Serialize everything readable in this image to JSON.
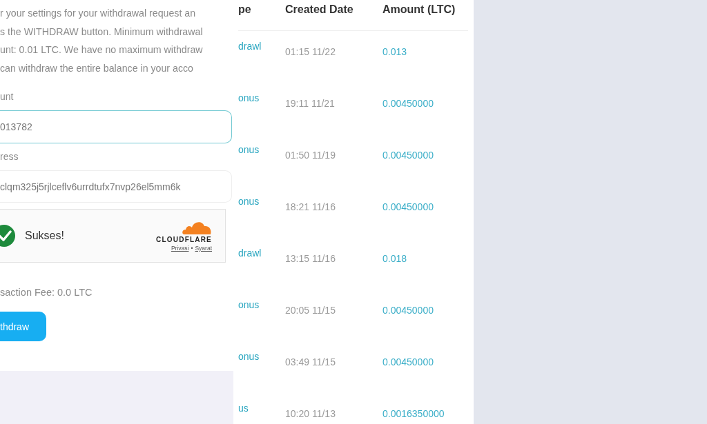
{
  "withdraw_form": {
    "intro_lines": [
      "r your settings for your withdrawal request an",
      "s the WITHDRAW button. Minimum withdrawal",
      "unt: 0.01 LTC. We have no maximum withdraw",
      "can withdraw the entire balance in your acco"
    ],
    "amount_label": "unt",
    "amount_value": "013782",
    "address_label": "ress",
    "address_value": "clqm325j5rjlceflv6urrdtufx7nvp26el5mm6k",
    "captcha": {
      "status": "Sukses!",
      "verified": true,
      "brand": "CLOUDFLARE",
      "privacy_link": "Privasi",
      "separator": "•",
      "terms_link": "Syarat"
    },
    "fee_text": "saction Fee: 0.0 LTC",
    "withdraw_button": "thdraw"
  },
  "history_table": {
    "columns": [
      "pe",
      "Created Date",
      "Amount (LTC)"
    ],
    "rows": [
      [
        "drawl",
        "01:15 11/22",
        "0.013"
      ],
      [
        "onus",
        "19:11 11/21",
        "0.00450000"
      ],
      [
        "onus",
        "01:50 11/19",
        "0.00450000"
      ],
      [
        "onus",
        "18:21 11/16",
        "0.00450000"
      ],
      [
        "drawl",
        "13:15 11/16",
        "0.018"
      ],
      [
        "onus",
        "20:05 11/15",
        "0.00450000"
      ],
      [
        "onus",
        "03:49 11/15",
        "0.00450000"
      ],
      [
        "us",
        "10:20 11/13",
        "0.0016350000"
      ]
    ]
  }
}
